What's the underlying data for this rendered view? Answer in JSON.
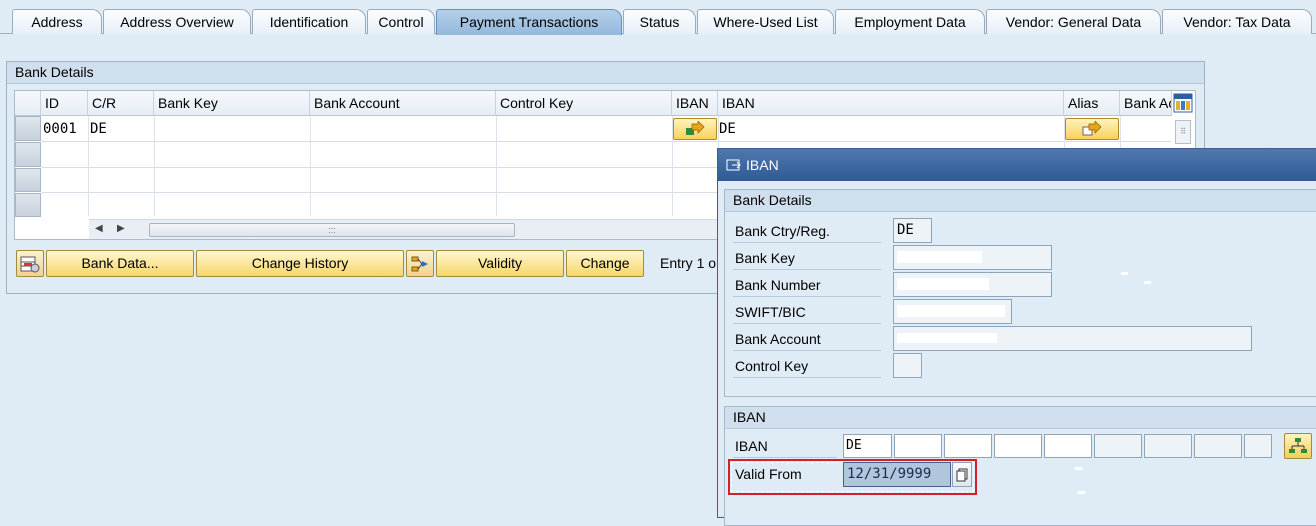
{
  "tabs": [
    "Address",
    "Address Overview",
    "Identification",
    "Control",
    "Payment Transactions",
    "Status",
    "Where-Used List",
    "Employment Data",
    "Vendor: General Data",
    "Vendor: Tax Data"
  ],
  "bank_details": {
    "title": "Bank Details",
    "columns": [
      "ID",
      "C/R",
      "Bank Key",
      "Bank Account",
      "Control Key",
      "IBAN",
      "IBAN",
      "Alias",
      "Bank Ac"
    ],
    "row": {
      "id": "0001",
      "country": "DE",
      "iban_prefix": "DE"
    },
    "buttons": {
      "bank_data": "Bank Data...",
      "change_history": "Change History",
      "validity": "Validity",
      "change": "Change"
    },
    "entry_text": "Entry 1 o"
  },
  "dialog": {
    "title": "IBAN",
    "bank_section": {
      "title": "Bank Details",
      "labels": [
        "Bank Ctry/Reg.",
        "Bank Key",
        "Bank Number",
        "SWIFT/BIC",
        "Bank Account",
        "Control Key"
      ],
      "country_value": "DE"
    },
    "iban_section": {
      "title": "IBAN",
      "iban_label": "IBAN",
      "iban_prefix": "DE",
      "valid_from_label": "Valid From",
      "valid_from_value": "12/31/9999"
    }
  },
  "colors": {
    "highlight": "#d61f29",
    "dialog_title_bg": "#2f5a94",
    "active_tab": "#a3c4e3",
    "button": "#f5d669"
  }
}
